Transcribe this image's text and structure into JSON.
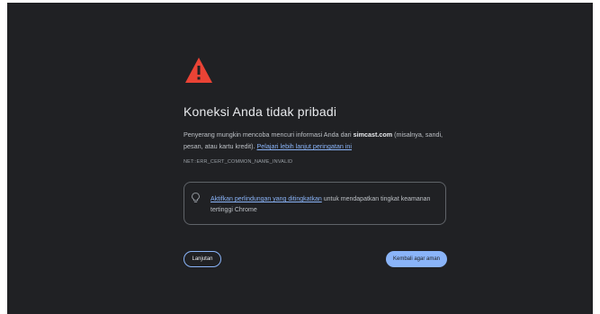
{
  "page": {
    "title": "Koneksi Anda tidak pribadi",
    "description": {
      "prefix": "Penyerang mungkin mencoba mencuri informasi Anda dari ",
      "domain": "simcast.com",
      "suffix": " (misalnya, sandi, pesan, atau kartu kredit). ",
      "learn_more_link": "Pelajari lebih lanjut peringatan ini"
    },
    "error_code": "NET::ERR_CERT_COMMON_NAME_INVALID",
    "protection": {
      "link": "Aktifkan perlindungan yang ditingkatkan",
      "text": " untuk mendapatkan tingkat keamanan tertinggi Chrome"
    },
    "buttons": {
      "advanced": "Lanjutan",
      "back_to_safety": "Kembali agar aman"
    }
  },
  "colors": {
    "background": "#202124",
    "warning": "#ea4335",
    "accent": "#8ab4f8",
    "text": "#e8eaed"
  },
  "icons": {
    "warning": "warning-triangle-icon",
    "bulb": "lightbulb-icon"
  }
}
